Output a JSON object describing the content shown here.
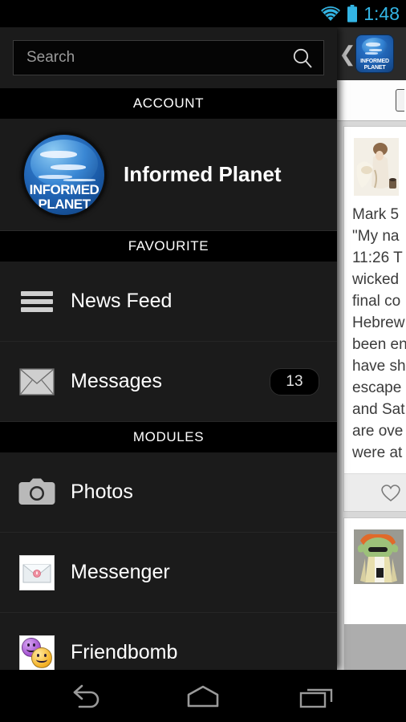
{
  "statusbar": {
    "clock": "1:48",
    "wifi_icon": "wifi-icon",
    "battery_icon": "battery-icon",
    "accent_color": "#33b5e5"
  },
  "drawer": {
    "search": {
      "placeholder": "Search",
      "value": "",
      "icon": "search-icon"
    },
    "sections": [
      {
        "header": "ACCOUNT",
        "account": {
          "name": "Informed Planet",
          "avatar_icon": "globe-avatar",
          "avatar_text_line1": "INFORMED",
          "avatar_text_line2": "PLANET"
        }
      },
      {
        "header": "FAVOURITE",
        "items": [
          {
            "label": "News Feed",
            "icon": "hamburger-icon",
            "badge": ""
          },
          {
            "label": "Messages",
            "icon": "envelope-icon",
            "badge": "13"
          }
        ]
      },
      {
        "header": "MODULES",
        "items": [
          {
            "label": "Photos",
            "icon": "camera-icon",
            "badge": ""
          },
          {
            "label": "Messenger",
            "icon": "mail-tile-icon",
            "badge": ""
          },
          {
            "label": "Friendbomb",
            "icon": "smileys-tile-icon",
            "badge": ""
          }
        ]
      }
    ]
  },
  "content": {
    "actionbar": {
      "back_icon": "back-chevron-icon",
      "brand_icon": "informed-planet-logo",
      "brand_text_line1": "INFORMED",
      "brand_text_line2": "PLANET"
    },
    "posts": [
      {
        "thumb_icon": "post-image-painting",
        "lines": [
          "Mark 5",
          "\"My na",
          "11:26 T",
          "wicked",
          "final co",
          "Hebrew",
          "been en",
          "have sh",
          "escape",
          "and Sat",
          "are ove",
          "were at"
        ],
        "like_icon": "heart-icon"
      },
      {
        "thumb_icon": "post-image-character",
        "lines": []
      }
    ]
  },
  "navbar": {
    "buttons": [
      {
        "name": "back-button",
        "icon": "back-arrow-icon"
      },
      {
        "name": "home-button",
        "icon": "home-icon"
      },
      {
        "name": "recents-button",
        "icon": "recents-icon"
      }
    ]
  }
}
